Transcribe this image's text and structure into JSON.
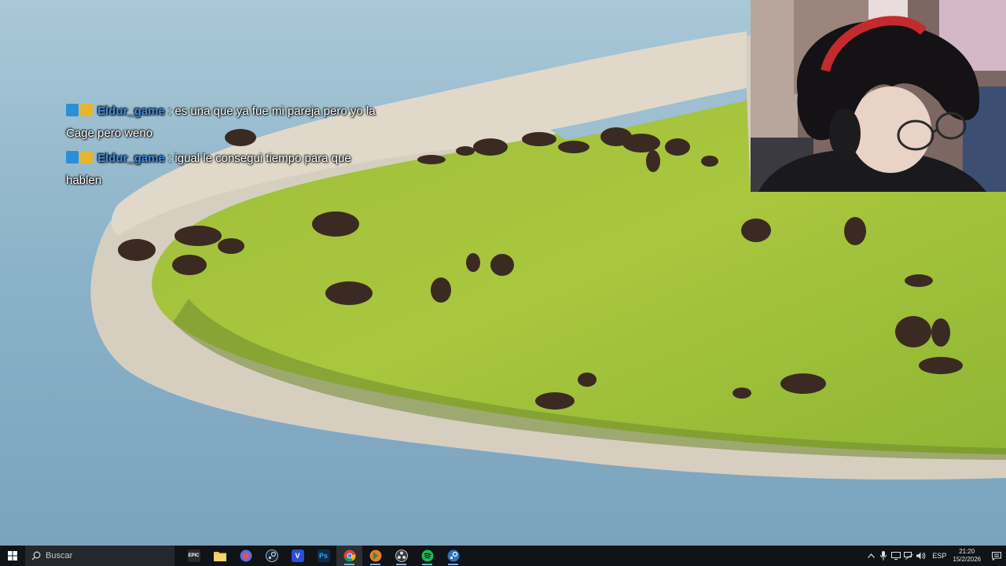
{
  "chat": {
    "messages": [
      {
        "user": "Eldur_game",
        "separator": ":",
        "text": "es una que ya fue mi pareja pero yo la Cage pero weno"
      },
      {
        "user": "Eldur_game",
        "separator": ":",
        "text": "igual le consegui tiempo para que hablen"
      }
    ]
  },
  "taskbar": {
    "search_placeholder": "Buscar",
    "apps": [
      {
        "name": "epic-games",
        "icon_text": "EPIC",
        "color": "#2b2b2b"
      },
      {
        "name": "file-explorer",
        "icon_text": "",
        "color": "#f0c64a"
      },
      {
        "name": "app-circle",
        "icon_text": "",
        "color": "#5a6fd8"
      },
      {
        "name": "steam",
        "icon_text": "",
        "color": "#1b2838"
      },
      {
        "name": "vegas",
        "icon_text": "V",
        "color": "#2a4fd6"
      },
      {
        "name": "photoshop",
        "icon_text": "Ps",
        "color": "#0f2a4a"
      },
      {
        "name": "chrome",
        "icon_text": "",
        "color": "#3c8de6"
      },
      {
        "name": "app-orange",
        "icon_text": "",
        "color": "#e87c2a"
      },
      {
        "name": "obs",
        "icon_text": "",
        "color": "#3a3a3a"
      },
      {
        "name": "spotify",
        "icon_text": "",
        "color": "#1db954"
      },
      {
        "name": "steam-2",
        "icon_text": "",
        "color": "#2a75bb"
      }
    ],
    "tray": {
      "language": "ESP",
      "time": "21:20",
      "date": "15/2/2026"
    }
  },
  "colors": {
    "taskbar_bg": "#101318",
    "chat_username": "#3e8ee8",
    "badge_mod": "#2a8fd6",
    "badge_sub": "#e6b52a"
  }
}
